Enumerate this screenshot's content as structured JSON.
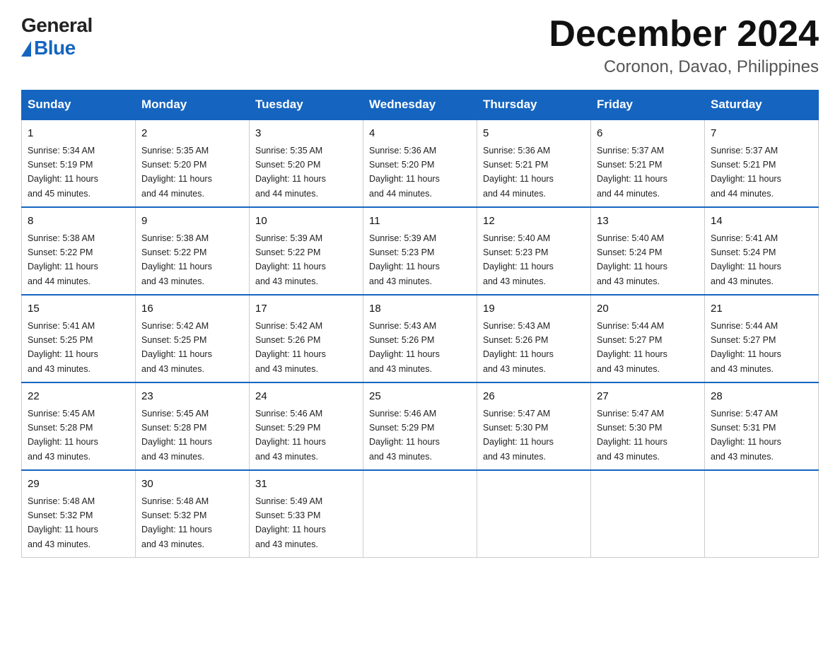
{
  "logo": {
    "general": "General",
    "blue": "Blue"
  },
  "header": {
    "month_year": "December 2024",
    "location": "Coronon, Davao, Philippines"
  },
  "days_of_week": [
    "Sunday",
    "Monday",
    "Tuesday",
    "Wednesday",
    "Thursday",
    "Friday",
    "Saturday"
  ],
  "weeks": [
    [
      {
        "day": "1",
        "sunrise": "5:34 AM",
        "sunset": "5:19 PM",
        "daylight": "11 hours and 45 minutes."
      },
      {
        "day": "2",
        "sunrise": "5:35 AM",
        "sunset": "5:20 PM",
        "daylight": "11 hours and 44 minutes."
      },
      {
        "day": "3",
        "sunrise": "5:35 AM",
        "sunset": "5:20 PM",
        "daylight": "11 hours and 44 minutes."
      },
      {
        "day": "4",
        "sunrise": "5:36 AM",
        "sunset": "5:20 PM",
        "daylight": "11 hours and 44 minutes."
      },
      {
        "day": "5",
        "sunrise": "5:36 AM",
        "sunset": "5:21 PM",
        "daylight": "11 hours and 44 minutes."
      },
      {
        "day": "6",
        "sunrise": "5:37 AM",
        "sunset": "5:21 PM",
        "daylight": "11 hours and 44 minutes."
      },
      {
        "day": "7",
        "sunrise": "5:37 AM",
        "sunset": "5:21 PM",
        "daylight": "11 hours and 44 minutes."
      }
    ],
    [
      {
        "day": "8",
        "sunrise": "5:38 AM",
        "sunset": "5:22 PM",
        "daylight": "11 hours and 44 minutes."
      },
      {
        "day": "9",
        "sunrise": "5:38 AM",
        "sunset": "5:22 PM",
        "daylight": "11 hours and 43 minutes."
      },
      {
        "day": "10",
        "sunrise": "5:39 AM",
        "sunset": "5:22 PM",
        "daylight": "11 hours and 43 minutes."
      },
      {
        "day": "11",
        "sunrise": "5:39 AM",
        "sunset": "5:23 PM",
        "daylight": "11 hours and 43 minutes."
      },
      {
        "day": "12",
        "sunrise": "5:40 AM",
        "sunset": "5:23 PM",
        "daylight": "11 hours and 43 minutes."
      },
      {
        "day": "13",
        "sunrise": "5:40 AM",
        "sunset": "5:24 PM",
        "daylight": "11 hours and 43 minutes."
      },
      {
        "day": "14",
        "sunrise": "5:41 AM",
        "sunset": "5:24 PM",
        "daylight": "11 hours and 43 minutes."
      }
    ],
    [
      {
        "day": "15",
        "sunrise": "5:41 AM",
        "sunset": "5:25 PM",
        "daylight": "11 hours and 43 minutes."
      },
      {
        "day": "16",
        "sunrise": "5:42 AM",
        "sunset": "5:25 PM",
        "daylight": "11 hours and 43 minutes."
      },
      {
        "day": "17",
        "sunrise": "5:42 AM",
        "sunset": "5:26 PM",
        "daylight": "11 hours and 43 minutes."
      },
      {
        "day": "18",
        "sunrise": "5:43 AM",
        "sunset": "5:26 PM",
        "daylight": "11 hours and 43 minutes."
      },
      {
        "day": "19",
        "sunrise": "5:43 AM",
        "sunset": "5:26 PM",
        "daylight": "11 hours and 43 minutes."
      },
      {
        "day": "20",
        "sunrise": "5:44 AM",
        "sunset": "5:27 PM",
        "daylight": "11 hours and 43 minutes."
      },
      {
        "day": "21",
        "sunrise": "5:44 AM",
        "sunset": "5:27 PM",
        "daylight": "11 hours and 43 minutes."
      }
    ],
    [
      {
        "day": "22",
        "sunrise": "5:45 AM",
        "sunset": "5:28 PM",
        "daylight": "11 hours and 43 minutes."
      },
      {
        "day": "23",
        "sunrise": "5:45 AM",
        "sunset": "5:28 PM",
        "daylight": "11 hours and 43 minutes."
      },
      {
        "day": "24",
        "sunrise": "5:46 AM",
        "sunset": "5:29 PM",
        "daylight": "11 hours and 43 minutes."
      },
      {
        "day": "25",
        "sunrise": "5:46 AM",
        "sunset": "5:29 PM",
        "daylight": "11 hours and 43 minutes."
      },
      {
        "day": "26",
        "sunrise": "5:47 AM",
        "sunset": "5:30 PM",
        "daylight": "11 hours and 43 minutes."
      },
      {
        "day": "27",
        "sunrise": "5:47 AM",
        "sunset": "5:30 PM",
        "daylight": "11 hours and 43 minutes."
      },
      {
        "day": "28",
        "sunrise": "5:47 AM",
        "sunset": "5:31 PM",
        "daylight": "11 hours and 43 minutes."
      }
    ],
    [
      {
        "day": "29",
        "sunrise": "5:48 AM",
        "sunset": "5:32 PM",
        "daylight": "11 hours and 43 minutes."
      },
      {
        "day": "30",
        "sunrise": "5:48 AM",
        "sunset": "5:32 PM",
        "daylight": "11 hours and 43 minutes."
      },
      {
        "day": "31",
        "sunrise": "5:49 AM",
        "sunset": "5:33 PM",
        "daylight": "11 hours and 43 minutes."
      },
      null,
      null,
      null,
      null
    ]
  ],
  "labels": {
    "sunrise": "Sunrise:",
    "sunset": "Sunset:",
    "daylight": "Daylight:"
  }
}
